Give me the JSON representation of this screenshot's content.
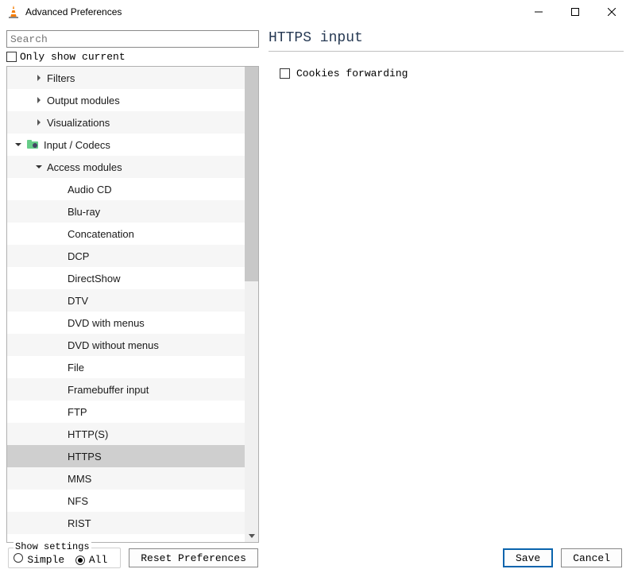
{
  "window": {
    "title": "Advanced Preferences"
  },
  "search": {
    "placeholder": "Search"
  },
  "only_show_current": "Only show current",
  "tree": [
    {
      "label": "Filters",
      "indent": 1,
      "chev": "right",
      "icon": false,
      "stripe": true
    },
    {
      "label": "Output modules",
      "indent": 1,
      "chev": "right",
      "icon": false
    },
    {
      "label": "Visualizations",
      "indent": 1,
      "chev": "right",
      "icon": false,
      "stripe": true
    },
    {
      "label": "Input / Codecs",
      "indent": 0,
      "chev": "down",
      "icon": true
    },
    {
      "label": "Access modules",
      "indent": 1,
      "chev": "down",
      "icon": false,
      "stripe": true
    },
    {
      "label": "Audio CD",
      "indent": 2,
      "chev": "",
      "icon": false
    },
    {
      "label": "Blu-ray",
      "indent": 2,
      "chev": "",
      "icon": false,
      "stripe": true
    },
    {
      "label": "Concatenation",
      "indent": 2,
      "chev": "",
      "icon": false
    },
    {
      "label": "DCP",
      "indent": 2,
      "chev": "",
      "icon": false,
      "stripe": true
    },
    {
      "label": "DirectShow",
      "indent": 2,
      "chev": "",
      "icon": false
    },
    {
      "label": "DTV",
      "indent": 2,
      "chev": "",
      "icon": false,
      "stripe": true
    },
    {
      "label": "DVD with menus",
      "indent": 2,
      "chev": "",
      "icon": false
    },
    {
      "label": "DVD without menus",
      "indent": 2,
      "chev": "",
      "icon": false,
      "stripe": true
    },
    {
      "label": "File",
      "indent": 2,
      "chev": "",
      "icon": false
    },
    {
      "label": "Framebuffer input",
      "indent": 2,
      "chev": "",
      "icon": false,
      "stripe": true
    },
    {
      "label": "FTP",
      "indent": 2,
      "chev": "",
      "icon": false
    },
    {
      "label": "HTTP(S)",
      "indent": 2,
      "chev": "",
      "icon": false,
      "stripe": true
    },
    {
      "label": "HTTPS",
      "indent": 2,
      "chev": "",
      "icon": false,
      "selected": true
    },
    {
      "label": "MMS",
      "indent": 2,
      "chev": "",
      "icon": false,
      "stripe": true
    },
    {
      "label": "NFS",
      "indent": 2,
      "chev": "",
      "icon": false
    },
    {
      "label": "RIST",
      "indent": 2,
      "chev": "",
      "icon": false,
      "stripe": true
    }
  ],
  "panel": {
    "title": "HTTPS input",
    "option_label": "Cookies forwarding"
  },
  "footer": {
    "show_settings": "Show settings",
    "simple": "Simple",
    "all": "All",
    "reset": "Reset Preferences",
    "save": "Save",
    "cancel": "Cancel"
  }
}
